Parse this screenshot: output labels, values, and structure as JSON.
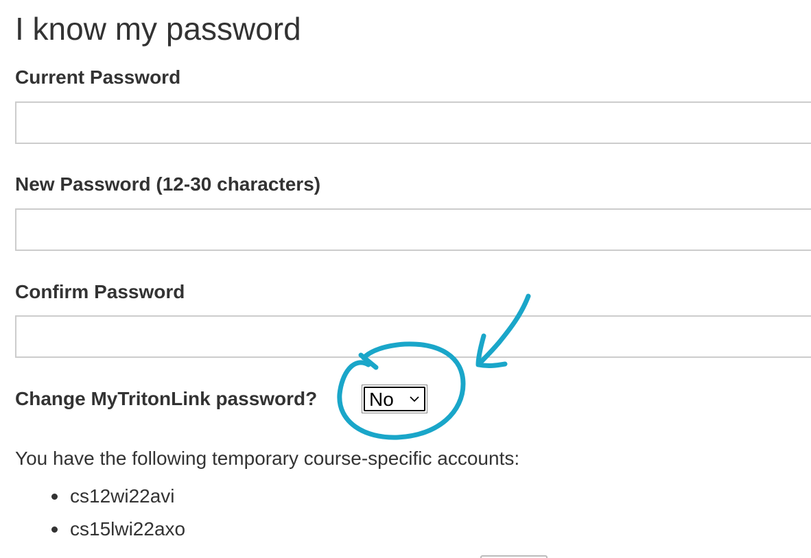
{
  "page": {
    "title": "I know my password"
  },
  "form": {
    "current_password": {
      "label": "Current Password",
      "value": ""
    },
    "new_password": {
      "label": "New Password (12-30 characters)",
      "value": ""
    },
    "confirm_password": {
      "label": "Confirm Password",
      "value": ""
    },
    "mytritonlink": {
      "label": "Change MyTritonLink password?",
      "selected": "No"
    }
  },
  "accounts": {
    "intro": "You have the following temporary course-specific accounts:",
    "items": [
      "cs12wi22avi",
      "cs15lwi22axo"
    ]
  },
  "annotation": {
    "color": "#1aa6c9",
    "icons": [
      "circle-annotation",
      "arrow-annotation"
    ]
  }
}
